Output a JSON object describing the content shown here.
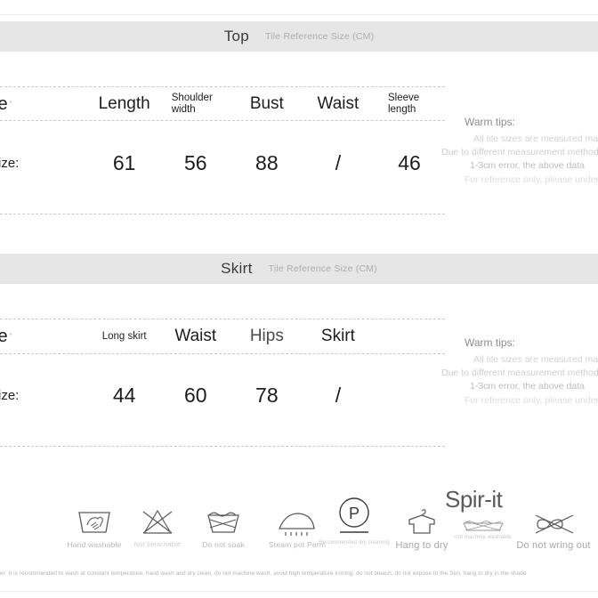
{
  "sections": [
    {
      "title": "Top",
      "subtitle": "Tile Reference Size (CM)",
      "headers": {
        "size": "ize",
        "size_tick": "'",
        "cols": [
          "Length",
          "Shoulder width",
          "Bust",
          "Waist",
          "Sleeve length"
        ]
      },
      "row": {
        "label": "e size:",
        "values": [
          "61",
          "56",
          "88",
          "/",
          "46"
        ]
      },
      "tips": {
        "title": "Warm tips:",
        "line1": "All tile sizes are measured man",
        "line2": "Due to different measurement methods, there",
        "line3": "1-3cm error, the above data",
        "line4": "For reference only, please understan"
      }
    },
    {
      "title": "Skirt",
      "subtitle": "Tile Reference Size (CM)",
      "headers": {
        "size": "ize",
        "size_tick": "'",
        "cols": [
          "Long skirt",
          "Waist",
          "Hips",
          "Skirt"
        ]
      },
      "row": {
        "label": "e size:",
        "values": [
          "44",
          "60",
          "78",
          "/"
        ]
      },
      "tips": {
        "title": "Warm tips:",
        "line1": "All tile sizes are measured man",
        "line2": "Due to different measurement methods, there",
        "line3": "1-3cm error, the above data",
        "line4": "For reference only, please understan"
      }
    }
  ],
  "care": {
    "items": [
      {
        "icon": "hand-wash-icon",
        "label": "Hand washable"
      },
      {
        "icon": "no-bleach-icon",
        "label": "Not bleachable"
      },
      {
        "icon": "do-not-soak-icon",
        "label": "Do not soak"
      },
      {
        "icon": "steam-iron-icon",
        "label": "Steam pot Perm"
      },
      {
        "icon": "dry-clean-p-icon",
        "label": "Recommended dry cleaning"
      },
      {
        "icon": "hang-to-dry-icon",
        "label": "Hang to dry"
      },
      {
        "icon": "no-machine-wash-icon",
        "label": "not machine washable"
      },
      {
        "icon": "do-not-wring-icon",
        "label": "Do not wring out"
      }
    ],
    "watermark": "Spir-it",
    "note": "er: It is recommended to wash at constant temperature, hand wash and dry clean, do not machine wash, avoid high temperature ironing, do not bleach, do not expose to the Sun, hang to dry in the shade"
  },
  "colors": {
    "bar": "#e6e6e6",
    "text": "#1d1d1d",
    "muted": "#adadad",
    "dash": "#c9c9c9"
  }
}
